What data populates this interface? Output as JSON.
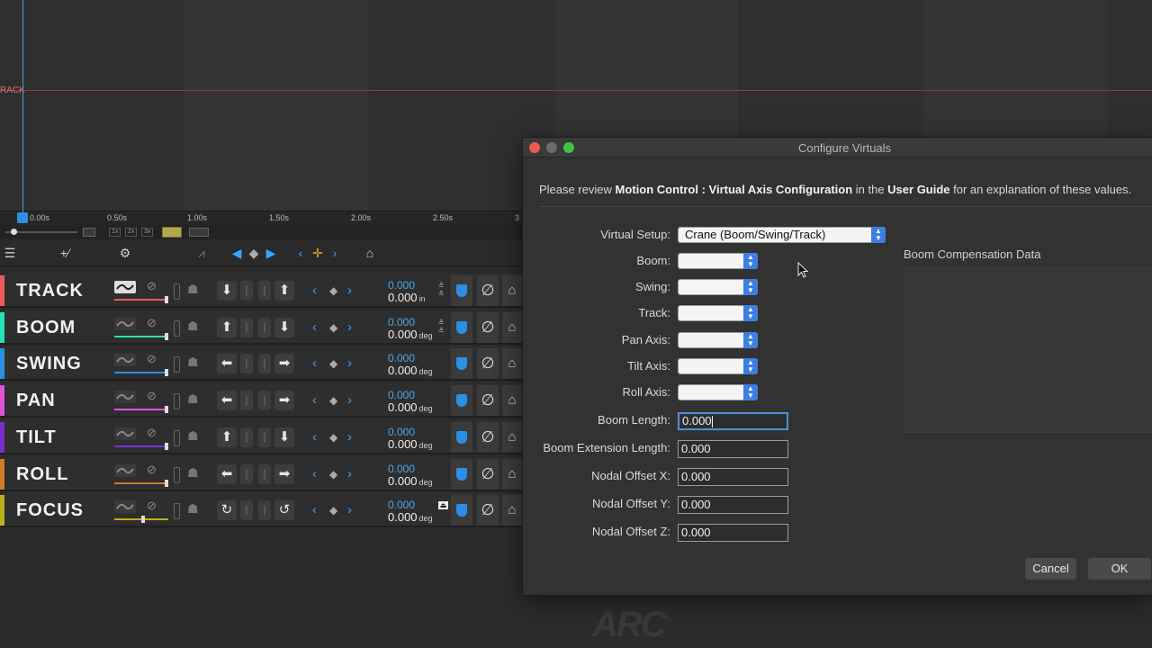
{
  "timeline": {
    "graph_label": "RACK",
    "ruler_ticks": [
      "0.00s",
      "0.50s",
      "1.00s",
      "1.50s",
      "2.00s",
      "2.50s",
      "3"
    ],
    "zoom_buttons": [
      "1x",
      "2x",
      "3x"
    ]
  },
  "toolbar": {
    "add_curve": "+",
    "nav_prev": "◀",
    "nav_key": "◆",
    "nav_next": "▶"
  },
  "channels": [
    {
      "name": "TRACK",
      "color": "#f25a5a",
      "v1": "0.000",
      "v2": "0.000",
      "unit": "in",
      "jog": [
        "⬇",
        "⬆"
      ]
    },
    {
      "name": "BOOM",
      "color": "#26e0b4",
      "v1": "0.000",
      "v2": "0.000",
      "unit": "deg",
      "jog": [
        "⬆",
        "⬇"
      ]
    },
    {
      "name": "SWING",
      "color": "#2b8fe6",
      "v1": "0.000",
      "v2": "0.000",
      "unit": "deg",
      "jog": [
        "⬅",
        "➡"
      ]
    },
    {
      "name": "PAN",
      "color": "#e052d8",
      "v1": "0.000",
      "v2": "0.000",
      "unit": "deg",
      "jog": [
        "⬅",
        "➡"
      ]
    },
    {
      "name": "TILT",
      "color": "#7a2ed0",
      "v1": "0.000",
      "v2": "0.000",
      "unit": "deg",
      "jog": [
        "⬆",
        "⬇"
      ]
    },
    {
      "name": "ROLL",
      "color": "#d07a2a",
      "v1": "0.000",
      "v2": "0.000",
      "unit": "deg",
      "jog": [
        "⬅",
        "➡"
      ]
    },
    {
      "name": "FOCUS",
      "color": "#b8b020",
      "v1": "0.000",
      "v2": "0.000",
      "unit": "deg",
      "jog": [
        "↻",
        "↺"
      ]
    }
  ],
  "logo": "ARC",
  "dialog": {
    "title": "Configure Virtuals",
    "intro_pre": "Please review ",
    "intro_bold1": "Motion Control : Virtual Axis Configuration",
    "intro_mid": " in the ",
    "intro_bold2": "User Guide",
    "intro_post": " for an explanation of these values.",
    "virtual_setup_label": "Virtual Setup:",
    "virtual_setup_value": "Crane (Boom/Swing/Track)",
    "axis_selects": [
      {
        "label": "Boom:",
        "value": ""
      },
      {
        "label": "Swing:",
        "value": ""
      },
      {
        "label": "Track:",
        "value": ""
      },
      {
        "label": "Pan Axis:",
        "value": ""
      },
      {
        "label": "Tilt Axis:",
        "value": ""
      },
      {
        "label": "Roll Axis:",
        "value": ""
      }
    ],
    "text_fields": [
      {
        "label": "Boom Length:",
        "value": "0.000"
      },
      {
        "label": "Boom Extension Length:",
        "value": "0.000"
      },
      {
        "label": "Nodal Offset X:",
        "value": "0.000"
      },
      {
        "label": "Nodal Offset Y:",
        "value": "0.000"
      },
      {
        "label": "Nodal Offset Z:",
        "value": "0.000"
      }
    ],
    "compensation_title": "Boom Compensation Data",
    "cancel_label": "Cancel",
    "ok_label": "OK"
  },
  "colors": {
    "accent": "#3aa3ff",
    "close": "#ee5a52",
    "minimize": "#6b6b6b",
    "zoom": "#3fc43f"
  }
}
